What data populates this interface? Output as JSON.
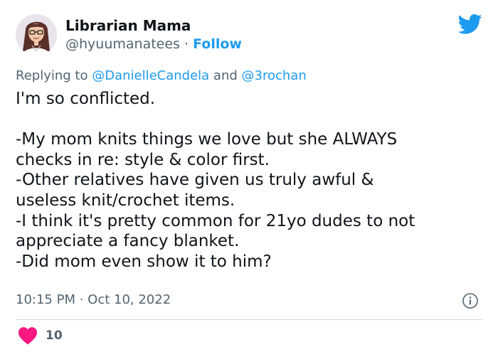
{
  "author": {
    "display_name": "Librarian Mama",
    "handle": "@hyuumanatees",
    "separator": " · ",
    "follow_label": "Follow"
  },
  "reply_context": {
    "prefix": "Replying to ",
    "mention_1": "@DanielleCandela",
    "joiner": " and ",
    "mention_2": "@3rochan"
  },
  "body": "I'm so conflicted.\n\n-My mom knits things we love but she ALWAYS\nchecks in re: style & color first.\n-Other relatives have given us truly awful &\nuseless knit/crochet items.\n-I think it's pretty common for 21yo dudes to not\nappreciate a fancy blanket.\n-Did mom even show it to him?",
  "timestamp": "10:15 PM · Oct 10, 2022",
  "likes": {
    "count": "10"
  },
  "colors": {
    "accent": "#1d9bf0",
    "like": "#f91880",
    "secondary_text": "#536471",
    "primary_text": "#0f1419",
    "divider": "#cfd9de"
  },
  "icons": {
    "brand": "twitter-bird-icon",
    "info": "info-icon",
    "like": "heart-icon"
  }
}
